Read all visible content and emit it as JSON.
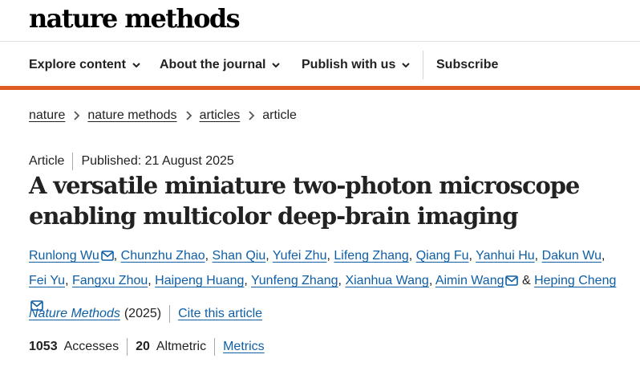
{
  "brand": {
    "logo": "nature methods"
  },
  "nav": {
    "explore": "Explore content",
    "about": "About the journal",
    "publish": "Publish with us",
    "subscribe": "Subscribe"
  },
  "colors": {
    "accent": "#e05a24",
    "link": "#0f5fa6",
    "text": "#222222"
  },
  "icons": {
    "dropdown": "chevron-down-icon",
    "breadcrumb": "chevron-right-icon",
    "email": "mail-icon"
  },
  "breadcrumb": {
    "items": [
      "nature",
      "nature methods",
      "articles"
    ],
    "current": "article"
  },
  "article": {
    "type": "Article",
    "published": "Published: 21 August 2025",
    "title": "A versatile miniature two-photon microscope enabling multicolor deep-brain imaging"
  },
  "authors": {
    "list": [
      "Runlong Wu",
      "Chunzhu Zhao",
      "Shan Qiu",
      "Yufei Zhu",
      "Lifeng Zhang",
      "Qiang Fu",
      "Yanhui Hu",
      "Dakun Wu",
      "Fei Yu",
      "Fangxu Zhou",
      "Haipeng Huang",
      "Yunfeng Zhang",
      "Xianhua Wang",
      "Aimin Wang",
      "Heping Cheng"
    ],
    "separator": ",",
    "conjunction": "&"
  },
  "citation": {
    "journal": "Nature Methods",
    "year": "(2025)",
    "cite_label": "Cite this article"
  },
  "metrics": {
    "accesses_count": "1053",
    "accesses_label": "Accesses",
    "altmetric_count": "20",
    "altmetric_label": "Altmetric",
    "metrics_link": "Metrics"
  }
}
